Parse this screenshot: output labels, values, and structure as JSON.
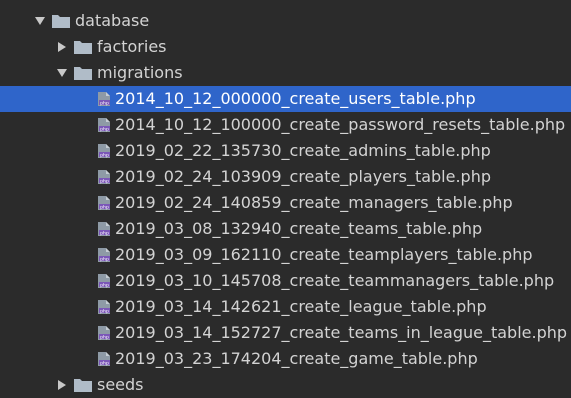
{
  "tree": {
    "root": {
      "label": "database",
      "expanded": true
    },
    "folders": [
      {
        "label": "factories",
        "expanded": false
      },
      {
        "label": "migrations",
        "expanded": true
      }
    ],
    "files": [
      {
        "label": "2014_10_12_000000_create_users_table.php",
        "selected": true
      },
      {
        "label": "2014_10_12_100000_create_password_resets_table.php",
        "selected": false
      },
      {
        "label": "2019_02_22_135730_create_admins_table.php",
        "selected": false
      },
      {
        "label": "2019_02_24_103909_create_players_table.php",
        "selected": false
      },
      {
        "label": "2019_02_24_140859_create_managers_table.php",
        "selected": false
      },
      {
        "label": "2019_03_08_132940_create_teams_table.php",
        "selected": false
      },
      {
        "label": "2019_03_09_162110_create_teamplayers_table.php",
        "selected": false
      },
      {
        "label": "2019_03_10_145708_create_teammanagers_table.php",
        "selected": false
      },
      {
        "label": "2019_03_14_142621_create_league_table.php",
        "selected": false
      },
      {
        "label": "2019_03_14_152727_create_teams_in_league_table.php",
        "selected": false
      },
      {
        "label": "2019_03_23_174204_create_game_table.php",
        "selected": false
      }
    ],
    "after": [
      {
        "label": "seeds",
        "expanded": false
      }
    ]
  },
  "colors": {
    "background": "#2b2b2b",
    "selection": "#2f65ca",
    "text": "#d3d3d3",
    "folder": "#a9b7c6"
  },
  "icons": {
    "expanded": "chevron-down-icon",
    "collapsed": "chevron-right-icon",
    "folder": "folder-icon",
    "file": "php-file-icon"
  }
}
